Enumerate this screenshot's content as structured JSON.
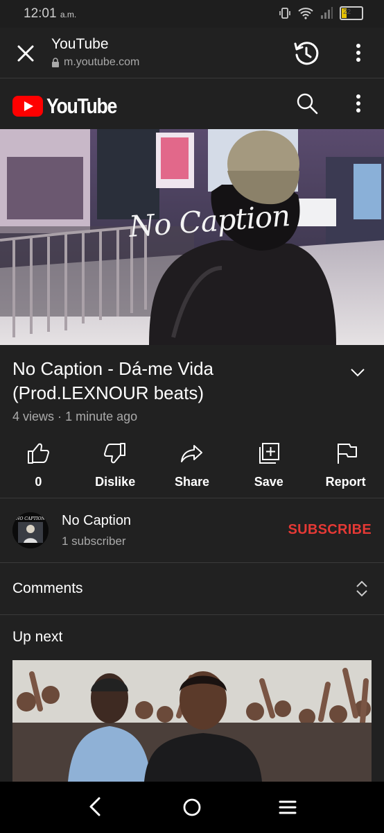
{
  "status_bar": {
    "time": "12:01",
    "ampm": "a.m.",
    "battery": "22"
  },
  "browser": {
    "title": "YouTube",
    "url": "m.youtube.com"
  },
  "youtube": {
    "logo_text": "YouTube"
  },
  "video": {
    "overlay_caption": "No Caption",
    "title": "No Caption - Dá-me Vida (Prod.LEXNOUR beats)",
    "views": "4 views",
    "separator": "·",
    "age": "1 minute ago"
  },
  "actions": [
    {
      "icon": "thumbs-up-icon",
      "label": "0"
    },
    {
      "icon": "thumbs-down-icon",
      "label": "Dislike"
    },
    {
      "icon": "share-icon",
      "label": "Share"
    },
    {
      "icon": "save-playlist-icon",
      "label": "Save"
    },
    {
      "icon": "flag-icon",
      "label": "Report"
    }
  ],
  "channel": {
    "name": "No Caption",
    "subscribers": "1 subscriber",
    "subscribe_label": "SUBSCRIBE",
    "avatar_text": "NO CAPTION"
  },
  "comments": {
    "label": "Comments"
  },
  "up_next": {
    "label": "Up next"
  },
  "colors": {
    "background": "#212121",
    "subscribe": "#e53935",
    "logo_red": "#ff0000"
  }
}
